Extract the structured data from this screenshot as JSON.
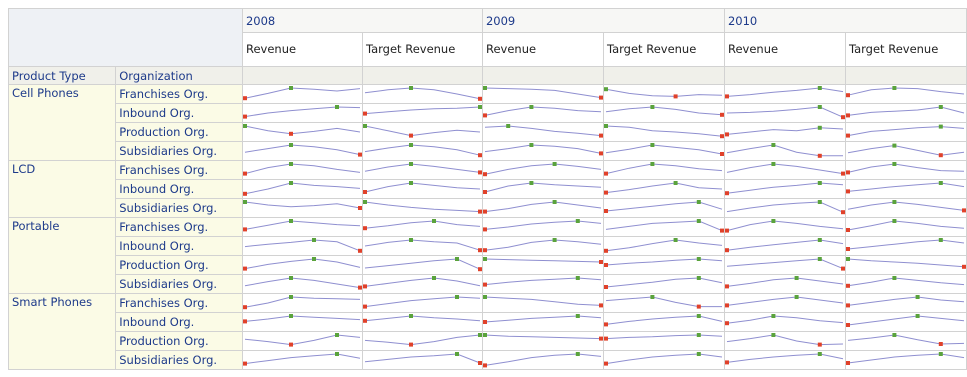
{
  "columns": [
    {
      "year": "2008",
      "measures": [
        "Revenue",
        "Target Revenue"
      ]
    },
    {
      "year": "2009",
      "measures": [
        "Revenue",
        "Target Revenue"
      ]
    },
    {
      "year": "2010",
      "measures": [
        "Revenue",
        "Target Revenue"
      ]
    }
  ],
  "row_headers": {
    "product_type": "Product Type",
    "organization": "Organization"
  },
  "colors": {
    "line": "#8f8fd0",
    "high_marker": "#5aa33c",
    "low_marker": "#e0412a",
    "header_text": "#1d3a8a",
    "row_header_bg": "#fbfbe6"
  },
  "groups": [
    {
      "product": "Cell Phones",
      "rows": [
        {
          "org": "Franchises Org.",
          "sparks": [
            [
              0.15,
              0.55,
              1.0,
              0.9,
              0.75,
              0.95
            ],
            [
              0.6,
              0.85,
              1.0,
              0.85,
              0.5,
              0.1
            ],
            [
              1.0,
              0.95,
              0.9,
              0.8,
              0.5,
              0.2
            ],
            [
              0.9,
              0.55,
              0.35,
              0.3,
              0.45,
              0.4
            ],
            [
              0.3,
              0.45,
              0.65,
              0.8,
              1.0,
              0.7
            ],
            [
              0.4,
              0.85,
              1.0,
              0.95,
              0.7,
              0.5
            ]
          ]
        },
        {
          "org": "Inbound Org.",
          "sparks": [
            [
              0.2,
              0.5,
              0.7,
              0.85,
              1.0,
              0.95
            ],
            [
              0.45,
              0.6,
              0.75,
              0.85,
              0.9,
              1.0
            ],
            [
              0.3,
              0.7,
              1.0,
              0.9,
              0.7,
              0.6
            ],
            [
              0.6,
              0.85,
              1.0,
              0.8,
              0.5,
              0.35
            ],
            [
              0.5,
              0.55,
              0.65,
              0.8,
              1.0,
              0.15
            ],
            [
              0.3,
              0.55,
              0.65,
              0.75,
              1.0,
              0.5
            ]
          ]
        },
        {
          "org": "Production Org.",
          "sparks": [
            [
              1.0,
              0.6,
              0.35,
              0.55,
              0.8,
              0.5
            ],
            [
              1.0,
              0.6,
              0.2,
              0.45,
              0.65,
              0.5
            ],
            [
              0.9,
              1.0,
              0.8,
              0.55,
              0.4,
              0.2
            ],
            [
              1.0,
              0.9,
              0.6,
              0.5,
              0.35,
              0.15
            ],
            [
              0.3,
              0.5,
              0.7,
              0.6,
              0.85,
              0.75
            ],
            [
              0.2,
              0.55,
              0.7,
              0.85,
              0.95,
              0.8
            ]
          ]
        },
        {
          "org": "Subsidiaries Org.",
          "sparks": [
            [
              0.4,
              0.7,
              1.0,
              0.85,
              0.6,
              0.2
            ],
            [
              0.45,
              0.75,
              1.0,
              0.85,
              0.6,
              0.15
            ],
            [
              0.45,
              0.7,
              1.0,
              0.9,
              0.7,
              0.3
            ],
            [
              0.35,
              0.65,
              1.0,
              0.8,
              0.6,
              0.25
            ],
            [
              0.35,
              0.7,
              1.0,
              0.4,
              0.1,
              0.1
            ],
            [
              0.35,
              0.7,
              0.95,
              0.55,
              0.15,
              0.4
            ]
          ]
        }
      ]
    },
    {
      "product": "LCD",
      "rows": [
        {
          "org": "Franchises Org.",
          "sparks": [
            [
              0.2,
              0.7,
              1.0,
              0.85,
              0.55,
              0.3
            ],
            [
              0.4,
              0.75,
              1.0,
              0.8,
              0.55,
              0.3
            ],
            [
              0.15,
              0.55,
              0.85,
              1.0,
              0.8,
              0.55
            ],
            [
              0.2,
              0.65,
              1.0,
              0.85,
              0.6,
              0.45
            ],
            [
              0.3,
              0.7,
              1.0,
              0.8,
              0.5,
              0.2
            ],
            [
              0.3,
              0.75,
              1.0,
              0.7,
              0.45,
              0.4
            ]
          ]
        },
        {
          "org": "Inbound Org.",
          "sparks": [
            [
              0.1,
              0.5,
              1.0,
              0.8,
              0.7,
              0.55
            ],
            [
              0.25,
              0.7,
              1.0,
              0.8,
              0.6,
              0.5
            ],
            [
              0.25,
              0.75,
              1.0,
              0.85,
              0.75,
              0.65
            ],
            [
              0.2,
              0.45,
              0.75,
              1.0,
              0.6,
              0.5
            ],
            [
              0.15,
              0.4,
              0.65,
              0.8,
              1.0,
              0.85
            ],
            [
              0.3,
              0.5,
              0.7,
              0.85,
              1.0,
              0.7
            ]
          ]
        },
        {
          "org": "Subsidiaries Org.",
          "sparks": [
            [
              1.0,
              0.75,
              0.6,
              0.7,
              0.85,
              0.5
            ],
            [
              1.0,
              0.75,
              0.55,
              0.4,
              0.3,
              0.2
            ],
            [
              0.2,
              0.45,
              0.8,
              1.0,
              0.75,
              0.5
            ],
            [
              0.25,
              0.45,
              0.65,
              0.85,
              1.0,
              0.4
            ],
            [
              0.2,
              0.5,
              0.75,
              0.9,
              1.0,
              0.15
            ],
            [
              0.4,
              0.75,
              1.0,
              0.8,
              0.55,
              0.3
            ]
          ]
        }
      ]
    },
    {
      "product": "Portable",
      "rows": [
        {
          "org": "Franchises Org.",
          "sparks": [
            [
              0.3,
              0.65,
              1.0,
              0.85,
              0.7,
              0.6
            ],
            [
              0.4,
              0.6,
              0.85,
              1.0,
              0.7,
              0.55
            ],
            [
              0.3,
              0.5,
              0.75,
              0.9,
              1.0,
              0.8
            ],
            [
              0.3,
              0.55,
              0.8,
              0.9,
              1.0,
              0.2
            ],
            [
              0.2,
              0.7,
              1.0,
              0.8,
              0.55,
              0.35
            ],
            [
              0.25,
              0.6,
              1.0,
              0.8,
              0.55,
              0.4
            ]
          ]
        },
        {
          "org": "Inbound Org.",
          "sparks": [
            [
              0.45,
              0.65,
              0.8,
              1.0,
              0.85,
              0.1
            ],
            [
              0.5,
              0.8,
              1.0,
              0.85,
              0.75,
              0.15
            ],
            [
              0.15,
              0.4,
              0.8,
              1.0,
              0.85,
              0.65
            ],
            [
              0.1,
              0.35,
              0.7,
              1.0,
              0.75,
              0.55
            ],
            [
              0.15,
              0.4,
              0.6,
              0.8,
              1.0,
              0.7
            ],
            [
              0.25,
              0.45,
              0.65,
              0.85,
              1.0,
              0.75
            ]
          ]
        },
        {
          "org": "Production Org.",
          "sparks": [
            [
              0.2,
              0.55,
              0.8,
              1.0,
              0.75,
              0.3
            ],
            [
              0.25,
              0.45,
              0.65,
              0.85,
              1.0,
              0.15
            ],
            [
              1.0,
              0.95,
              0.9,
              0.85,
              0.8,
              0.75
            ],
            [
              0.5,
              0.65,
              0.75,
              0.9,
              1.0,
              0.85
            ],
            [
              0.4,
              0.55,
              0.7,
              0.85,
              1.0,
              0.2
            ],
            [
              1.0,
              0.85,
              0.75,
              0.65,
              0.5,
              0.35
            ]
          ]
        },
        {
          "org": "Subsidiaries Org.",
          "sparks": [
            [
              0.35,
              0.7,
              1.0,
              0.8,
              0.5,
              0.2
            ],
            [
              0.3,
              0.55,
              0.8,
              1.0,
              0.75,
              0.35
            ],
            [
              0.45,
              0.65,
              0.8,
              0.9,
              1.0,
              0.85
            ],
            [
              0.25,
              0.45,
              0.65,
              0.9,
              1.0,
              0.6
            ],
            [
              0.3,
              0.55,
              0.85,
              1.0,
              0.75,
              0.5
            ],
            [
              0.35,
              0.65,
              1.0,
              0.8,
              0.6,
              0.45
            ]
          ]
        }
      ]
    },
    {
      "product": "Smart Phones",
      "rows": [
        {
          "org": "Franchises Org.",
          "sparks": [
            [
              0.15,
              0.5,
              1.0,
              0.9,
              0.85,
              0.8
            ],
            [
              0.2,
              0.45,
              0.7,
              0.85,
              1.0,
              0.9
            ],
            [
              1.0,
              0.9,
              0.8,
              0.6,
              0.4,
              0.3
            ],
            [
              0.7,
              0.85,
              1.0,
              0.55,
              0.2,
              0.2
            ],
            [
              0.3,
              0.55,
              0.8,
              1.0,
              0.75,
              0.5
            ],
            [
              0.3,
              0.55,
              0.8,
              1.0,
              0.75,
              0.6
            ]
          ]
        },
        {
          "org": "Inbound Org.",
          "sparks": [
            [
              0.55,
              0.75,
              1.0,
              0.9,
              0.8,
              0.7
            ],
            [
              0.6,
              0.8,
              1.0,
              0.85,
              0.75,
              0.6
            ],
            [
              0.5,
              0.65,
              0.8,
              0.9,
              1.0,
              0.85
            ],
            [
              0.3,
              0.55,
              0.75,
              0.9,
              1.0,
              0.55
            ],
            [
              0.4,
              0.65,
              1.0,
              0.85,
              0.6,
              0.45
            ],
            [
              0.25,
              0.5,
              0.75,
              1.0,
              0.8,
              0.6
            ]
          ]
        },
        {
          "org": "Production Org.",
          "sparks": [
            [
              0.65,
              0.45,
              0.2,
              0.55,
              1.0,
              0.8
            ],
            [
              0.55,
              0.4,
              0.2,
              0.45,
              0.8,
              1.0
            ],
            [
              1.0,
              0.9,
              0.85,
              0.8,
              0.75,
              0.7
            ],
            [
              0.7,
              0.8,
              0.85,
              0.95,
              1.0,
              0.9
            ],
            [
              0.45,
              0.7,
              1.0,
              0.5,
              0.2,
              0.25
            ],
            [
              0.55,
              0.75,
              1.0,
              0.6,
              0.25,
              0.3
            ]
          ]
        },
        {
          "org": "Subsidiaries Org.",
          "sparks": [
            [
              0.2,
              0.45,
              0.7,
              0.85,
              1.0,
              0.65
            ],
            [
              0.35,
              0.55,
              0.75,
              0.85,
              1.0,
              0.25
            ],
            [
              0.05,
              0.35,
              0.7,
              0.9,
              1.0,
              0.8
            ],
            [
              0.2,
              0.5,
              0.75,
              0.9,
              1.0,
              0.75
            ],
            [
              0.3,
              0.55,
              0.75,
              0.9,
              1.0,
              0.6
            ],
            [
              0.25,
              0.5,
              0.75,
              0.9,
              1.0,
              0.7
            ]
          ]
        }
      ]
    }
  ]
}
